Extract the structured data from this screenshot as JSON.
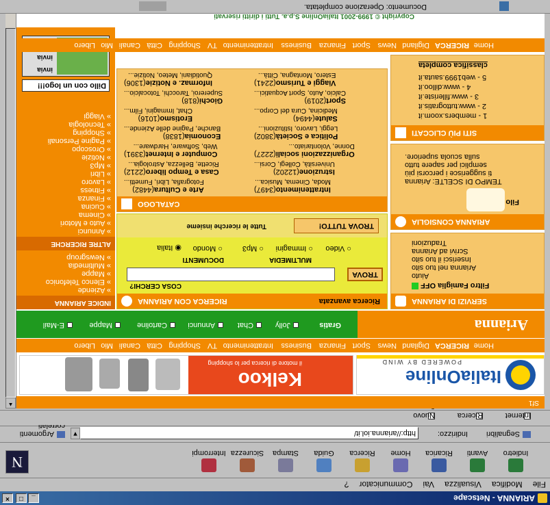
{
  "window": {
    "title": "ARIANNA - Netscape",
    "buttons": [
      "_",
      "□",
      "×"
    ]
  },
  "menu": [
    "File",
    "Modifica",
    "Visualizza",
    "Vai",
    "Communicator",
    "?"
  ],
  "toolbar": [
    "Indietro",
    "Avanti",
    "Ricarica",
    "Home",
    "Ricerca",
    "Guida",
    "Stampa",
    "Sicurezza",
    "Interrompi"
  ],
  "location": {
    "bookmarks_label": "Segnalibri",
    "address_label": "Indirizzo:",
    "url": "http://arianna.iol.it/",
    "related_label": "Argomenti correlati"
  },
  "personal_toolbar": [
    "Internet",
    "Ricerca",
    "Nuovo e curioso"
  ],
  "status_text": "Documento: Operazione completata.",
  "page": {
    "nav": [
      "Home",
      "RICERCA",
      "Digiland",
      "News",
      "Sport",
      "Finanza",
      "Business",
      "Intrattenimento",
      "TV",
      "Shopping",
      "Città",
      "Canali",
      "Mio",
      "Libero"
    ],
    "banner": {
      "italiaonline": "ItaliaOnline",
      "powered": "POWERED BY WIND",
      "kelkoo": "Kelkoo",
      "kelkoo_tag": "il motore di ricerca per lo shopping"
    },
    "footer_small": "Sf1",
    "services_strip": {
      "logo": "Arianna",
      "gratis": "Gratis",
      "items": [
        "Jolly",
        "Chat",
        "Annunci",
        "Cartoline",
        "Mappe",
        "E-Mail"
      ]
    },
    "left_sidebar": {
      "header_index": "INDICE ARIANNA",
      "links_top": [
        "Aziende",
        "Elenco Telefonico",
        "Mappe",
        "Multimedia",
        "Newsgroup"
      ],
      "header_other": "ALTRE RICERCHE",
      "links_bottom": [
        "Annunci",
        "Auto e Motori",
        "Cinema",
        "Cucina",
        "Finanza",
        "Fitness",
        "Lavoro",
        "Libri",
        "Mp3",
        "Notizie",
        "Oroscopo",
        "Pagine Personali",
        "Shopping",
        "Tecnologia",
        "Viaggi"
      ],
      "logo_caption": "Dillo con un logo!!!",
      "invia": "invia"
    },
    "search_box": {
      "title": "RICERCA CON ARIANNA",
      "advanced": "Ricerca avanzata",
      "cosa_cerchi": "COSA CERCHI?",
      "trova": "TROVA",
      "documenti": "DOCUMENTI",
      "multimedia": "MULTIMEDIA",
      "radios": [
        "Italia",
        "Mondo",
        "Mp3",
        "Immagini",
        "Video"
      ],
      "all_label": "Tutte le ricerche insieme",
      "trova_tutto": "TROVA TUTTO!"
    },
    "catalogo": {
      "title": "CATALOGO",
      "categories": [
        {
          "name": "Arte e Cultura",
          "count": "(4482)",
          "sub": "Fotografia, Libri, Fumetti..."
        },
        {
          "name": "Intrattenimento",
          "count": "(3497)",
          "sub": "Moda, Cinema, Musica..."
        },
        {
          "name": "Casa e Tempo libero",
          "count": "(2212)",
          "sub": "Ricette, Bellezza, Astrologia..."
        },
        {
          "name": "Istruzione",
          "count": "(12202)",
          "sub": "Università, Collegi, Corsi..."
        },
        {
          "name": "Computer e Internet",
          "count": "(3391)",
          "sub": "Web, Software, Hardware..."
        },
        {
          "name": "Organizzazioni sociali",
          "count": "(2227)",
          "sub": "Donne, Volontariato..."
        },
        {
          "name": "Economia",
          "count": "(1838)",
          "sub": "Banche, Pagine delle Aziende..."
        },
        {
          "name": "Politica e Società",
          "count": "(3802)",
          "sub": "Leggi, Lavoro, Istituzioni..."
        },
        {
          "name": "Erotismo",
          "count": "(1016)",
          "sub": "Chat, Immagini, Film..."
        },
        {
          "name": "Salute",
          "count": "(4494)",
          "sub": "Medicina, Cura del Corpo..."
        },
        {
          "name": "Giochi",
          "count": "(818)",
          "sub": "Supereroi, Tarocchi, Totocalcio..."
        },
        {
          "name": "Sport",
          "count": "(2019)",
          "sub": "Calcio, Auto, Sport Acquatici..."
        },
        {
          "name": "Informaz. e Notizie",
          "count": "(1306)",
          "sub": "Quotidiani, Meteo, Notizie..."
        },
        {
          "name": "Viaggi e Turismo",
          "count": "(2241)",
          "sub": "Estero, Montagna, Città..."
        }
      ]
    },
    "servizi": {
      "title": "SERVIZI DI ARIANNA",
      "items": [
        "Filtro Famiglia OFF",
        "Aiuto",
        "Arianna nel tuo sito",
        "Inserisci il tuo sito",
        "Scrivi ad Arianna",
        "Traduzioni"
      ]
    },
    "consiglia": {
      "title": "ARIANNA CONSIGLIA",
      "filo": "Filo di Arianna",
      "lines": [
        "TEMPO DI SCELTE: Arianna",
        "ti suggerisce i percorsi più",
        "semplici per sapere tutto",
        "sulla scuola superiore."
      ]
    },
    "cliccati": {
      "title": "SITI PIÙ CLICCATI",
      "items": [
        "1 - members.xoom.it",
        "2 - www.tuttogratis.it",
        "3 - www.filleriste.it",
        "4 - www.dilloo.it",
        "5 - web1999.sauta.it"
      ],
      "full": "classifica completa"
    },
    "copyright": "Copyright © 1999-2001 ItaliaOnline S.p.a. Tutti i diritti riservati"
  },
  "colors": {
    "orange": "#f28a00",
    "pale_orange": "#f6c66a",
    "yellow": "#eaea3a",
    "green": "#1f9a1f"
  }
}
